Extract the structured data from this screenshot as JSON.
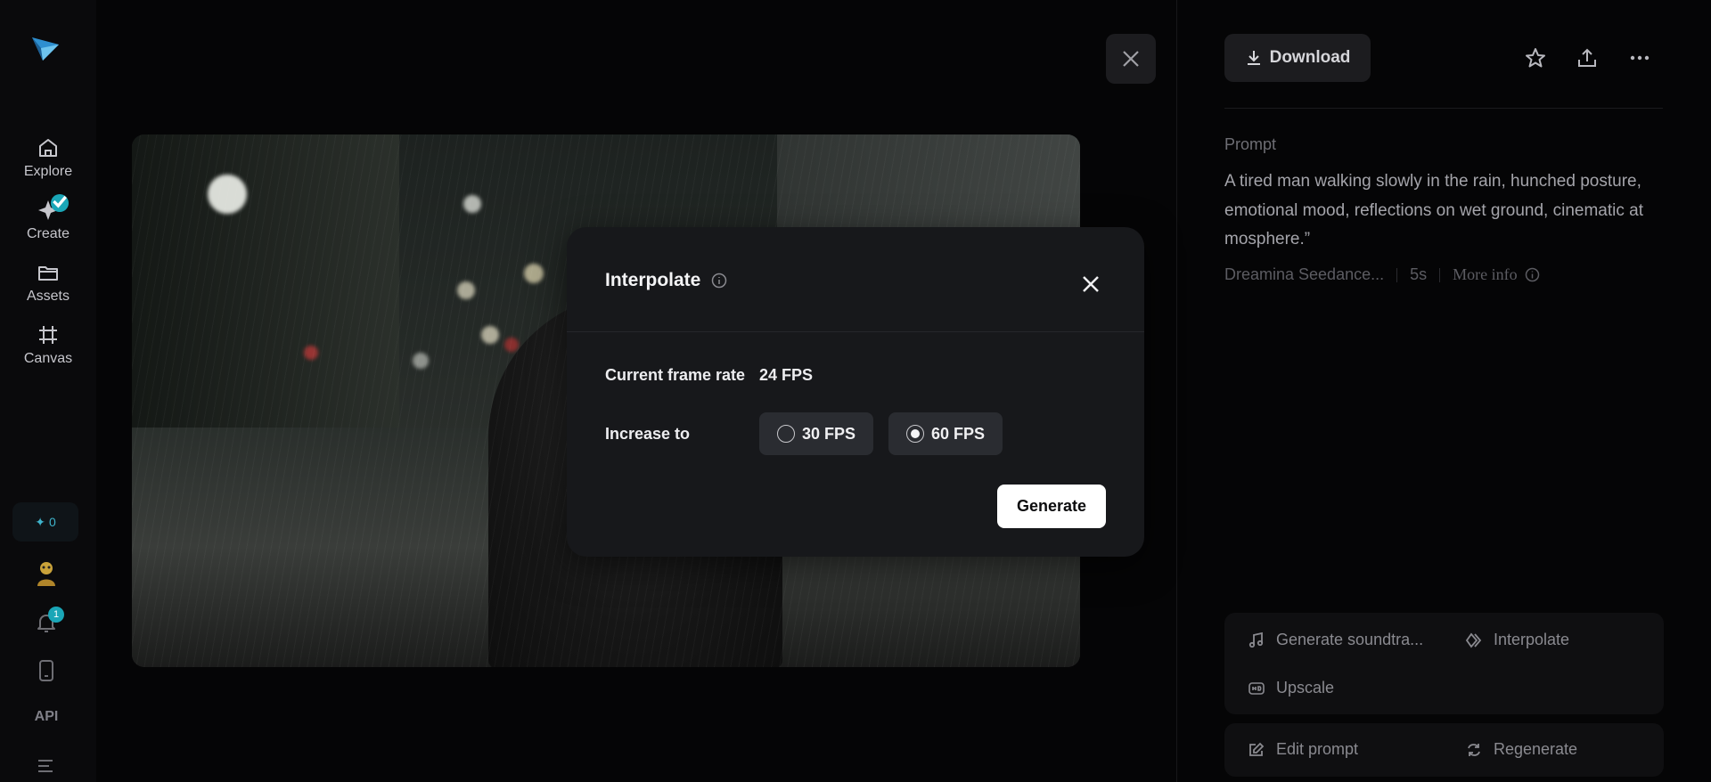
{
  "sidebar": {
    "items": [
      {
        "label": "Explore",
        "icon": "home-icon"
      },
      {
        "label": "Create",
        "icon": "create-icon"
      },
      {
        "label": "Assets",
        "icon": "folder-icon"
      },
      {
        "label": "Canvas",
        "icon": "canvas-icon"
      }
    ],
    "credits": "0",
    "notifications_count": "1",
    "api_label": "API"
  },
  "viewer": {
    "close_icon": "close-icon"
  },
  "panel": {
    "download_label": "Download",
    "prompt_label": "Prompt",
    "prompt_text": "A tired man walking slowly in the rain, hunched posture, emotional mood, reflections on wet ground, cinematic at mosphere.”",
    "model": "Dreamina Seedance...",
    "duration": "5s",
    "more_info": "More info",
    "tools": {
      "soundtrack": "Generate soundtra...",
      "interpolate": "Interpolate",
      "upscale": "Upscale",
      "edit_prompt": "Edit prompt",
      "regenerate": "Regenerate"
    }
  },
  "modal": {
    "title": "Interpolate",
    "current_label": "Current frame rate",
    "current_value": "24 FPS",
    "increase_label": "Increase to",
    "options": [
      {
        "label": "30 FPS",
        "selected": false
      },
      {
        "label": "60 FPS",
        "selected": true
      }
    ],
    "generate_label": "Generate"
  },
  "colors": {
    "accent": "#1aa6b7",
    "modal_bg": "#17181b",
    "page_bg": "#050506"
  }
}
